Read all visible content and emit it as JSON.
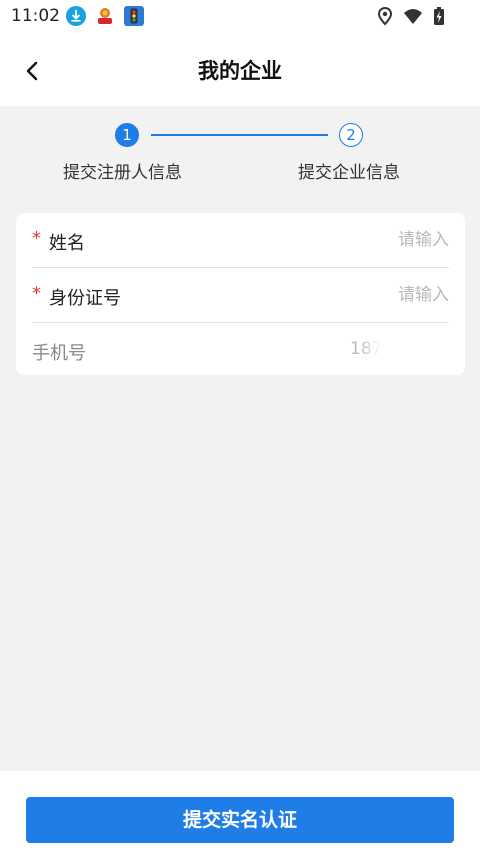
{
  "status_bar": {
    "time": "11:02",
    "icons": [
      "download-app-icon",
      "avatar-app-icon",
      "traffic-light-app-icon",
      "location-icon",
      "wifi-icon",
      "battery-charging-icon"
    ],
    "colors": {
      "download": "#1aa1e0",
      "traffic": "#2b7bd6"
    }
  },
  "header": {
    "back_icon": "chevron-left-icon",
    "title": "我的企业"
  },
  "stepper": {
    "steps": [
      {
        "number": "1",
        "label": "提交注册人信息",
        "active": true
      },
      {
        "number": "2",
        "label": "提交企业信息",
        "active": false
      }
    ]
  },
  "form": {
    "fields": [
      {
        "label": "姓名",
        "required": true,
        "required_mark": "*",
        "placeholder": "请输入",
        "value": ""
      },
      {
        "label": "身份证号",
        "required": true,
        "required_mark": "*",
        "placeholder": "请输入",
        "value": ""
      },
      {
        "label": "手机号",
        "required": false,
        "value": "187"
      }
    ]
  },
  "footer": {
    "submit_label": "提交实名认证"
  },
  "colors": {
    "accent": "#1e7de6",
    "required": "#e03a2f",
    "background": "#f2f2f2"
  }
}
